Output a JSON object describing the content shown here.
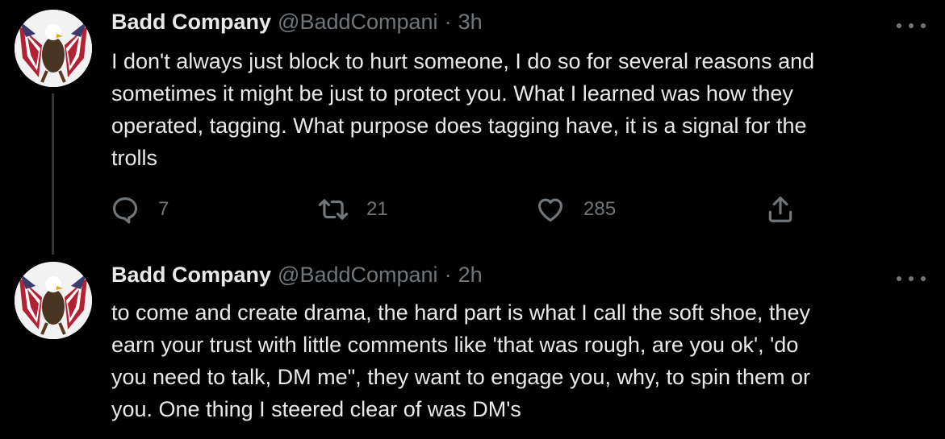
{
  "colors": {
    "background": "#000000",
    "primary_text": "#e7e9ea",
    "secondary_text": "#71767b",
    "thread_line": "#333639"
  },
  "tweets": [
    {
      "display_name": "Badd Company",
      "handle": "@BaddCompani",
      "separator": "·",
      "timestamp": "3h",
      "avatar_icon": "eagle-flag-avatar",
      "more_icon": "more-options-icon",
      "text": "I don't always just block to hurt someone, I do so for several reasons and\nsometimes it might be just to protect you. What I learned was how they\noperated, tagging. What purpose does tagging have, it is a signal for the\ntrolls",
      "actions": {
        "reply_count": "7",
        "retweet_count": "21",
        "like_count": "285"
      }
    },
    {
      "display_name": "Badd Company",
      "handle": "@BaddCompani",
      "separator": "·",
      "timestamp": "2h",
      "avatar_icon": "eagle-flag-avatar",
      "more_icon": "more-options-icon",
      "text": "to come and create drama, the hard part is what I call the soft shoe, they\nearn your trust with little comments like 'that was rough, are you ok', 'do\nyou need to talk, DM me\", they want to engage you, why, to spin them or\nyou. One thing I steered clear of was DM's"
    }
  ]
}
